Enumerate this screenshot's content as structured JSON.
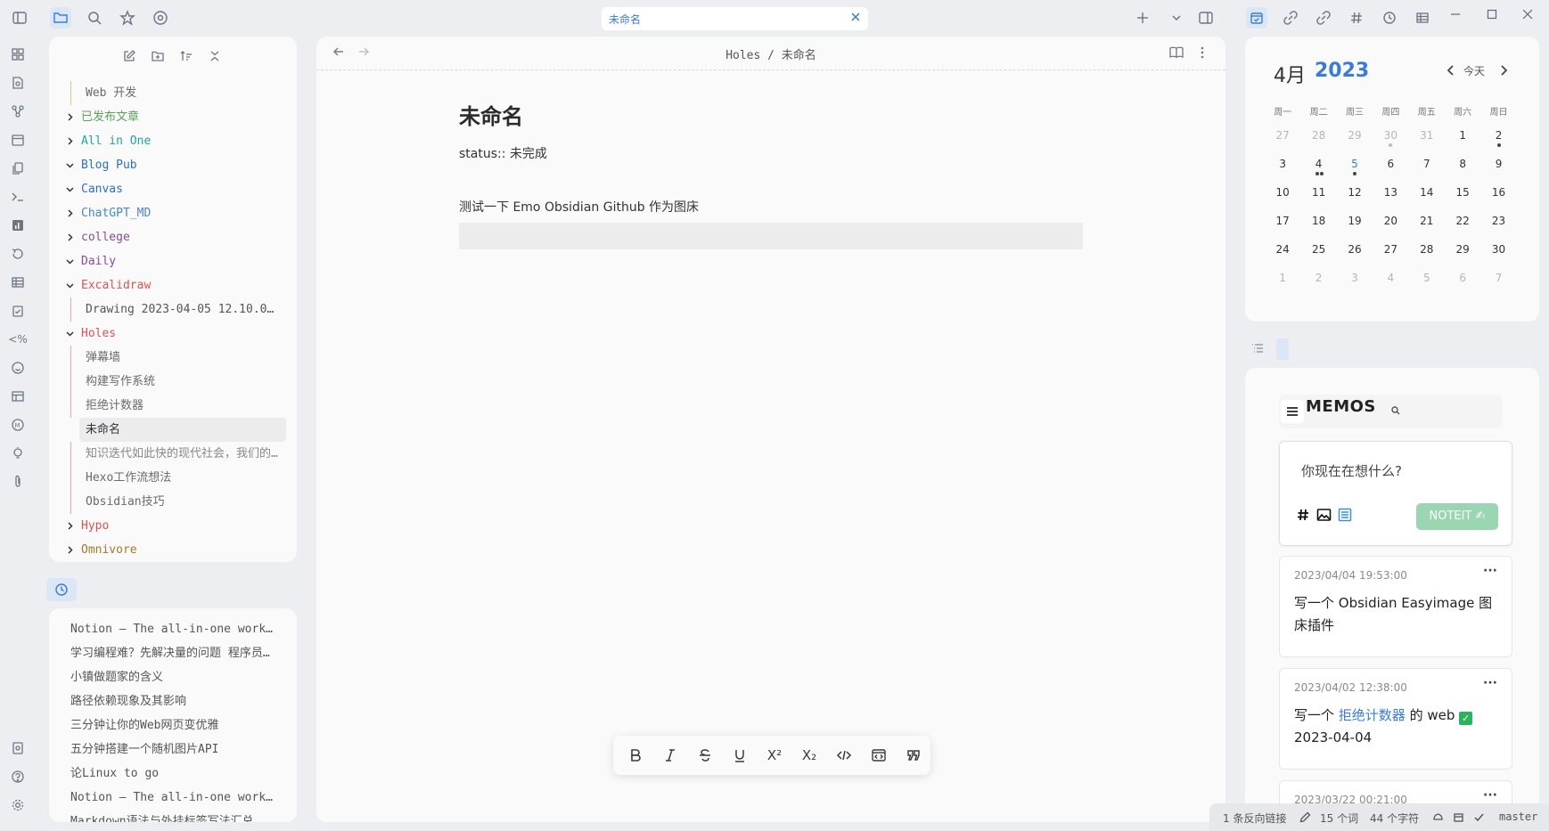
{
  "tab": {
    "title": "未命名"
  },
  "explorer": {
    "tree": [
      {
        "label": "Web 开发",
        "kind": "child",
        "color": "#6b6b6b",
        "line": "gold"
      },
      {
        "label": "已发布文章",
        "kind": "folder",
        "open": false,
        "color": "#5aa25a"
      },
      {
        "label": "All in One",
        "kind": "folder",
        "open": false,
        "color": "#22a3a3"
      },
      {
        "label": "Blog Pub",
        "kind": "folder",
        "open": true,
        "color": "#2f6fbf"
      },
      {
        "label": "Canvas",
        "kind": "folder",
        "open": true,
        "color": "#2f6fbf"
      },
      {
        "label": "ChatGPT_MD",
        "kind": "folder",
        "open": false,
        "color": "#4a86c8"
      },
      {
        "label": "college",
        "kind": "folder",
        "open": false,
        "color": "#8a4a9a"
      },
      {
        "label": "Daily",
        "kind": "folder",
        "open": true,
        "color": "#8a4a9a"
      },
      {
        "label": "Excalidraw",
        "kind": "folder",
        "open": true,
        "color": "#d9534f"
      },
      {
        "label": "Drawing 2023-04-05 12.10.0…",
        "kind": "child",
        "color": "#555"
      },
      {
        "label": "Holes",
        "kind": "folder",
        "open": true,
        "color": "#d9534f"
      },
      {
        "label": "弹幕墙",
        "kind": "child",
        "color": "#6b6b6b"
      },
      {
        "label": "构建写作系统",
        "kind": "child",
        "color": "#6b6b6b"
      },
      {
        "label": "拒绝计数器",
        "kind": "child",
        "color": "#6b6b6b"
      },
      {
        "label": "未命名",
        "kind": "child",
        "selected": true,
        "color": "#2e3338"
      },
      {
        "label": "知识迭代如此快的现代社会，我们的…",
        "kind": "child",
        "color": "#888"
      },
      {
        "label": "Hexo工作流想法",
        "kind": "child",
        "color": "#6b6b6b"
      },
      {
        "label": "Obsidian技巧",
        "kind": "child",
        "color": "#6b6b6b"
      },
      {
        "label": "Hypo",
        "kind": "folder",
        "open": false,
        "color": "#d9534f"
      },
      {
        "label": "Omnivore",
        "kind": "folder",
        "open": false,
        "color": "#a07a2a"
      }
    ]
  },
  "recent": [
    "Notion – The all-in-one work…",
    "学习编程难？先解决量的问题 程序员…",
    "小镇做题家的含义",
    "路径依赖现象及其影响",
    "三分钟让你的Web网页变优雅",
    "五分钟搭建一个随机图片API",
    "论Linux to go",
    "Notion – The all-in-one work…",
    "Markdown语法与外挂标签写法汇总"
  ],
  "editor": {
    "breadcrumb": "Holes / 未命名",
    "title": "未命名",
    "property": "status:: 未完成",
    "paragraph": "测试一下 Emo Obsidian Github 作为图床"
  },
  "calendar": {
    "month": "4月",
    "year": "2023",
    "today_label": "今天",
    "weekdays": [
      "周一",
      "周二",
      "周三",
      "周四",
      "周五",
      "周六",
      "周日"
    ],
    "weeks": [
      [
        "27",
        "28",
        "29",
        "30",
        "31",
        "1",
        "2"
      ],
      [
        "3",
        "4",
        "5",
        "6",
        "7",
        "8",
        "9"
      ],
      [
        "10",
        "11",
        "12",
        "13",
        "14",
        "15",
        "16"
      ],
      [
        "17",
        "18",
        "19",
        "20",
        "21",
        "22",
        "23"
      ],
      [
        "24",
        "25",
        "26",
        "27",
        "28",
        "29",
        "30"
      ],
      [
        "1",
        "2",
        "3",
        "4",
        "5",
        "6",
        "7"
      ]
    ],
    "today": "5"
  },
  "memos": {
    "title": "MEMOS",
    "placeholder": "你现在在想什么?",
    "submit": "NOTEIT ✍",
    "cards": [
      {
        "date": "2023/04/04 19:53:00",
        "text": "写一个 Obsidian Easyimage 图床插件"
      },
      {
        "date": "2023/04/02 12:38:00",
        "text_before": "写一个 ",
        "link": "拒绝计数器",
        "text_after": " 的 web ",
        "check": "✓",
        "line2": "2023-04-04"
      },
      {
        "date": "2023/03/22 00:21:00",
        "text": ""
      }
    ]
  },
  "statusbar": {
    "backlinks": "1 条反向链接",
    "words": "15 个词",
    "chars": "44 个字符",
    "branch": "master"
  }
}
